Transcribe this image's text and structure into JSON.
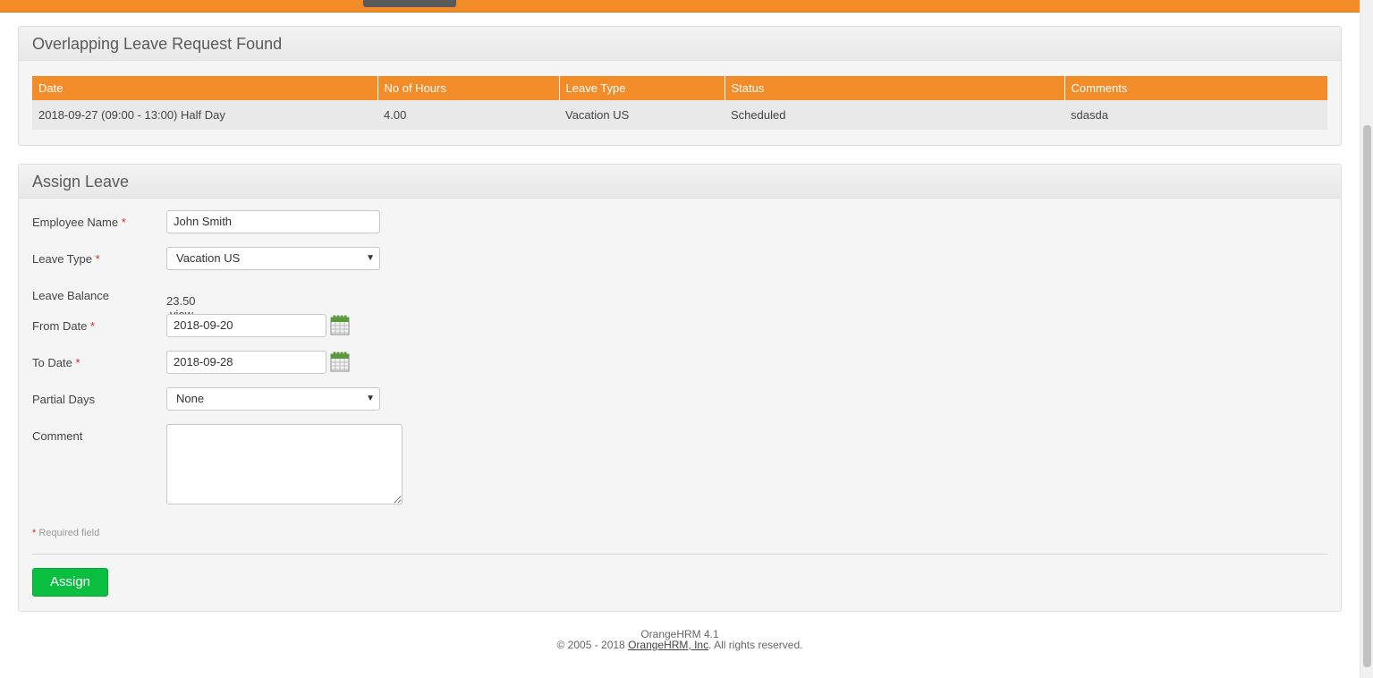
{
  "overlap": {
    "title": "Overlapping Leave Request Found",
    "columns": [
      "Date",
      "No of Hours",
      "Leave Type",
      "Status",
      "Comments"
    ],
    "rows": [
      {
        "date": "2018-09-27 (09:00 - 13:00) Half Day",
        "hours": "4.00",
        "leave_type": "Vacation US",
        "status": "Scheduled",
        "comments": "sdasda"
      }
    ]
  },
  "assign": {
    "title": "Assign Leave",
    "employee_label": "Employee Name",
    "employee_value": "John Smith",
    "leave_type_label": "Leave Type",
    "leave_type_value": "Vacation US",
    "balance_label": "Leave Balance",
    "balance_value": "23.50",
    "balance_link": "view details",
    "from_label": "From Date",
    "from_value": "2018-09-20",
    "to_label": "To Date",
    "to_value": "2018-09-28",
    "partial_label": "Partial Days",
    "partial_value": "None",
    "comment_label": "Comment",
    "required_star": "*",
    "required_note": "Required field",
    "assign_button": "Assign"
  },
  "footer": {
    "version": "OrangeHRM 4.1",
    "copyright_prefix": "© 2005 - 2018 ",
    "company_link": "OrangeHRM, Inc",
    "copyright_suffix": ". All rights reserved."
  },
  "colors": {
    "brand_orange": "#f28c28",
    "assign_green": "#0abf3f",
    "required_red": "#d62d20"
  },
  "icons": {
    "calendar": "calendar-icon",
    "dropdown": "chevron-down-icon"
  }
}
